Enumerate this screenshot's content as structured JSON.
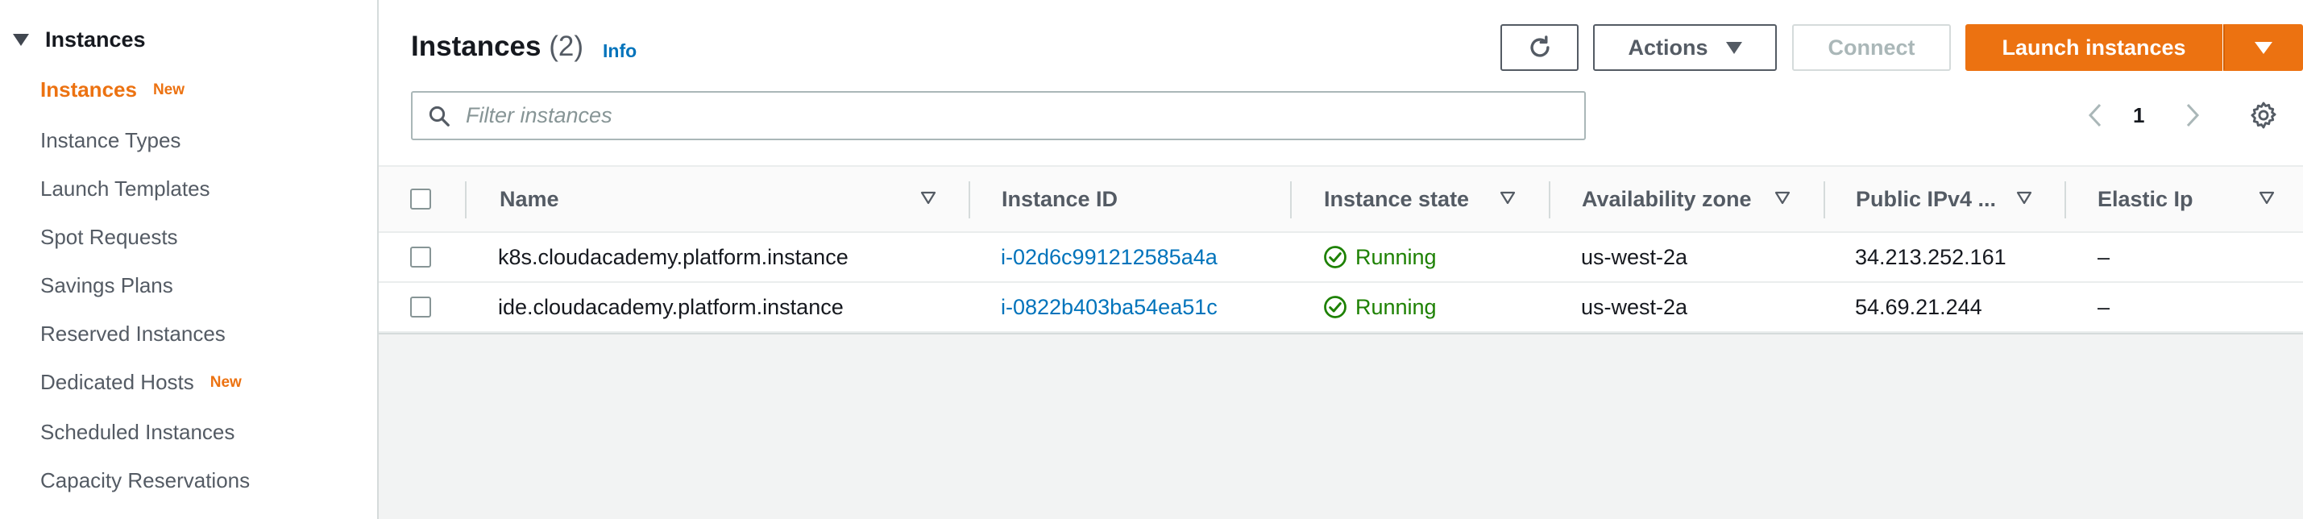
{
  "sidebar": {
    "header": "Instances",
    "items": [
      {
        "label": "Instances",
        "badge": "New"
      },
      {
        "label": "Instance Types",
        "badge": ""
      },
      {
        "label": "Launch Templates",
        "badge": ""
      },
      {
        "label": "Spot Requests",
        "badge": ""
      },
      {
        "label": "Savings Plans",
        "badge": ""
      },
      {
        "label": "Reserved Instances",
        "badge": ""
      },
      {
        "label": "Dedicated Hosts",
        "badge": "New"
      },
      {
        "label": "Scheduled Instances",
        "badge": ""
      },
      {
        "label": "Capacity Reservations",
        "badge": ""
      }
    ]
  },
  "header": {
    "title": "Instances",
    "count": "(2)",
    "info": "Info"
  },
  "toolbar": {
    "refresh_icon": "refresh-icon",
    "actions_label": "Actions",
    "connect_label": "Connect",
    "launch_label": "Launch instances"
  },
  "search": {
    "placeholder": "Filter instances",
    "value": ""
  },
  "pagination": {
    "current_page": "1"
  },
  "table": {
    "columns": [
      "Name",
      "Instance ID",
      "Instance state",
      "Availability zone",
      "Public IPv4 ...",
      "Elastic Ip"
    ],
    "rows": [
      {
        "name": "k8s.cloudacademy.platform.instance",
        "id": "i-02d6c991212585a4a",
        "state": "Running",
        "zone": "us-west-2a",
        "ipv4": "34.213.252.161",
        "elastic": "–"
      },
      {
        "name": "ide.cloudacademy.platform.instance",
        "id": "i-0822b403ba54ea51c",
        "state": "Running",
        "zone": "us-west-2a",
        "ipv4": "54.69.21.244",
        "elastic": "–"
      }
    ]
  },
  "colors": {
    "accent": "#ec7211",
    "link": "#0073bb",
    "running": "#1d8102"
  }
}
